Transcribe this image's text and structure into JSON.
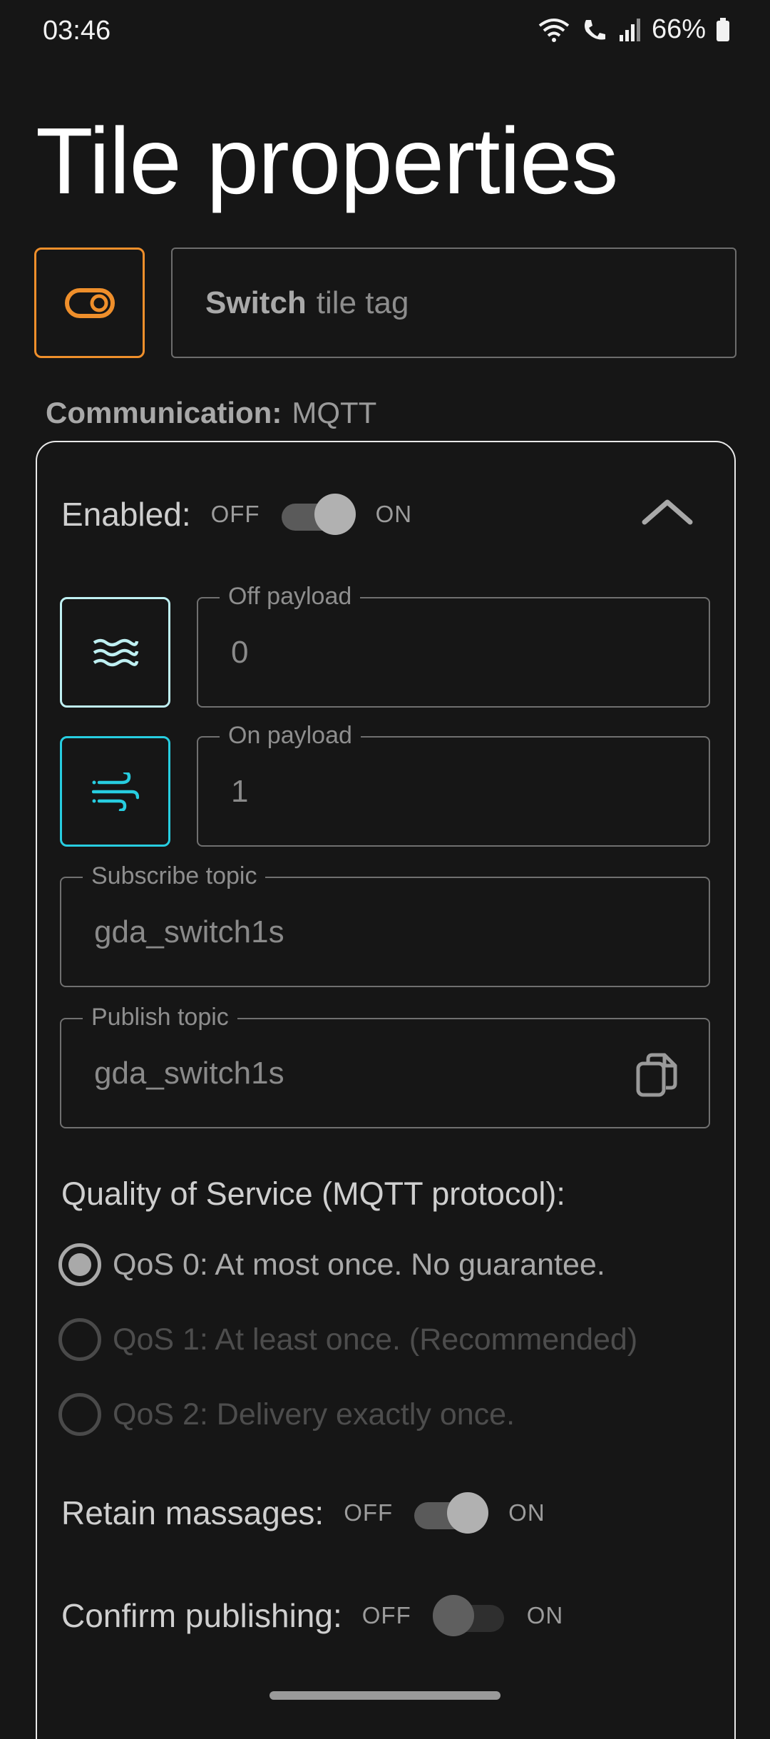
{
  "status_bar": {
    "time": "03:46",
    "battery": "66%",
    "icons": [
      "wifi-icon",
      "wifi-call-icon",
      "signal-icon",
      "battery-icon"
    ]
  },
  "page": {
    "title": "Tile properties"
  },
  "tile": {
    "icon": "toggle-switch-icon",
    "tag_type": "Switch",
    "tag_placeholder": "tile tag"
  },
  "communication": {
    "label": "Communication:",
    "value": "MQTT"
  },
  "mqtt": {
    "enabled": {
      "label": "Enabled:",
      "off": "OFF",
      "on": "ON",
      "state": "on"
    },
    "collapse_icon": "chevron-up-icon",
    "off_payload": {
      "icon": "waves-icon",
      "label": "Off payload",
      "value": "0"
    },
    "on_payload": {
      "icon": "wind-icon",
      "label": "On payload",
      "value": "1"
    },
    "subscribe_topic": {
      "label": "Subscribe topic",
      "value": "gda_switch1s"
    },
    "publish_topic": {
      "label": "Publish topic",
      "value": "gda_switch1s",
      "action_icon": "copy-icon"
    },
    "qos": {
      "heading": "Quality of Service (MQTT protocol):",
      "options": [
        {
          "label": "QoS 0: At most once. No guarantee.",
          "selected": true,
          "enabled": true
        },
        {
          "label": "QoS 1: At least once. (Recommended)",
          "selected": false,
          "enabled": false
        },
        {
          "label": "QoS 2: Delivery exactly once.",
          "selected": false,
          "enabled": false
        }
      ]
    },
    "retain": {
      "label": "Retain massages:",
      "off": "OFF",
      "on": "ON",
      "state": "on"
    },
    "confirm": {
      "label": "Confirm publishing:",
      "off": "OFF",
      "on": "ON",
      "state": "off"
    }
  },
  "colors": {
    "background": "#161616",
    "tile_accent": "#ef8f2b",
    "off_icon_accent": "#bff0f2",
    "on_icon_accent": "#27cde0"
  }
}
